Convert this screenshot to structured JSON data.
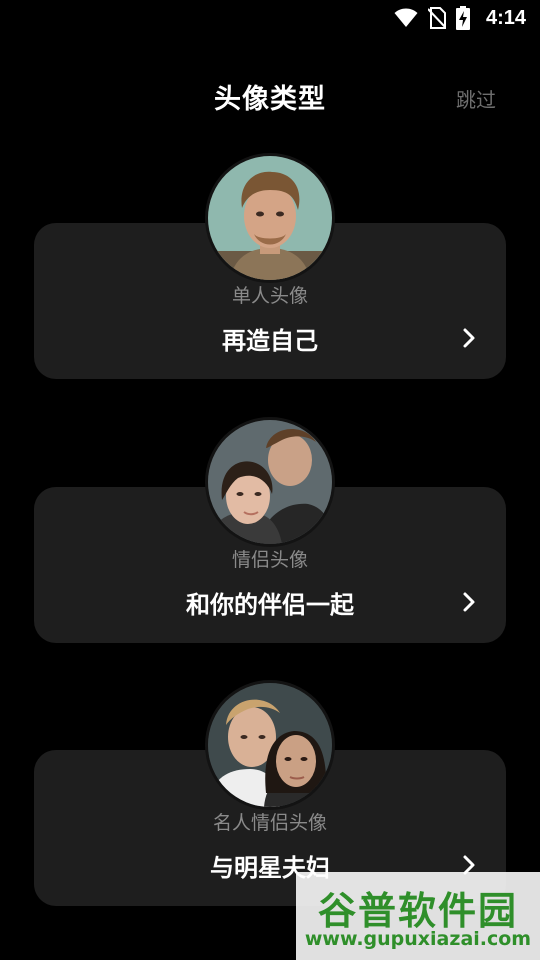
{
  "status_bar": {
    "time": "4:14",
    "icons": [
      "wifi-icon",
      "no-sim-icon",
      "battery-charging-icon"
    ]
  },
  "header": {
    "title": "头像类型",
    "skip_label": "跳过"
  },
  "cards": [
    {
      "subtitle": "单人头像",
      "title": "再造自己",
      "avatar": "single-portrait",
      "chevron": "chevron-right-icon"
    },
    {
      "subtitle": "情侣头像",
      "title": "和你的伴侣一起",
      "avatar": "couple-portrait",
      "chevron": "chevron-right-icon"
    },
    {
      "subtitle": "名人情侣头像",
      "title": "与明星夫妇",
      "avatar": "celebrity-couple-portrait",
      "chevron": "chevron-right-icon"
    }
  ],
  "watermark": {
    "name": "谷普软件园",
    "url": "www.gupuxiazai.com"
  },
  "colors": {
    "background": "#000000",
    "card": "#1e1e1e",
    "subtitle": "#8a8a8a",
    "skip": "#6e6e6e",
    "watermark_green": "#2f8f2a"
  }
}
